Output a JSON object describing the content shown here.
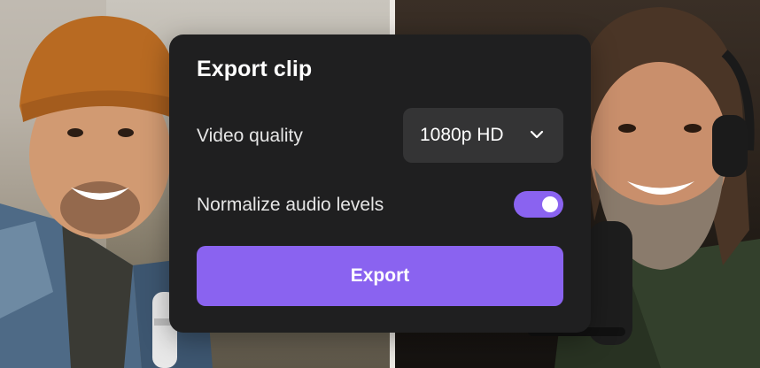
{
  "dialog": {
    "title": "Export clip",
    "video_quality": {
      "label": "Video quality",
      "selected": "1080p HD",
      "icon": "chevron-down-icon"
    },
    "normalize_audio": {
      "label": "Normalize audio levels",
      "enabled": true
    },
    "export_button": {
      "label": "Export"
    }
  },
  "colors": {
    "dialog_background": "#1f1f20",
    "select_background": "#343435",
    "accent": "#8a63f0",
    "button_background": "#8a63f0",
    "text": "#ffffff"
  }
}
